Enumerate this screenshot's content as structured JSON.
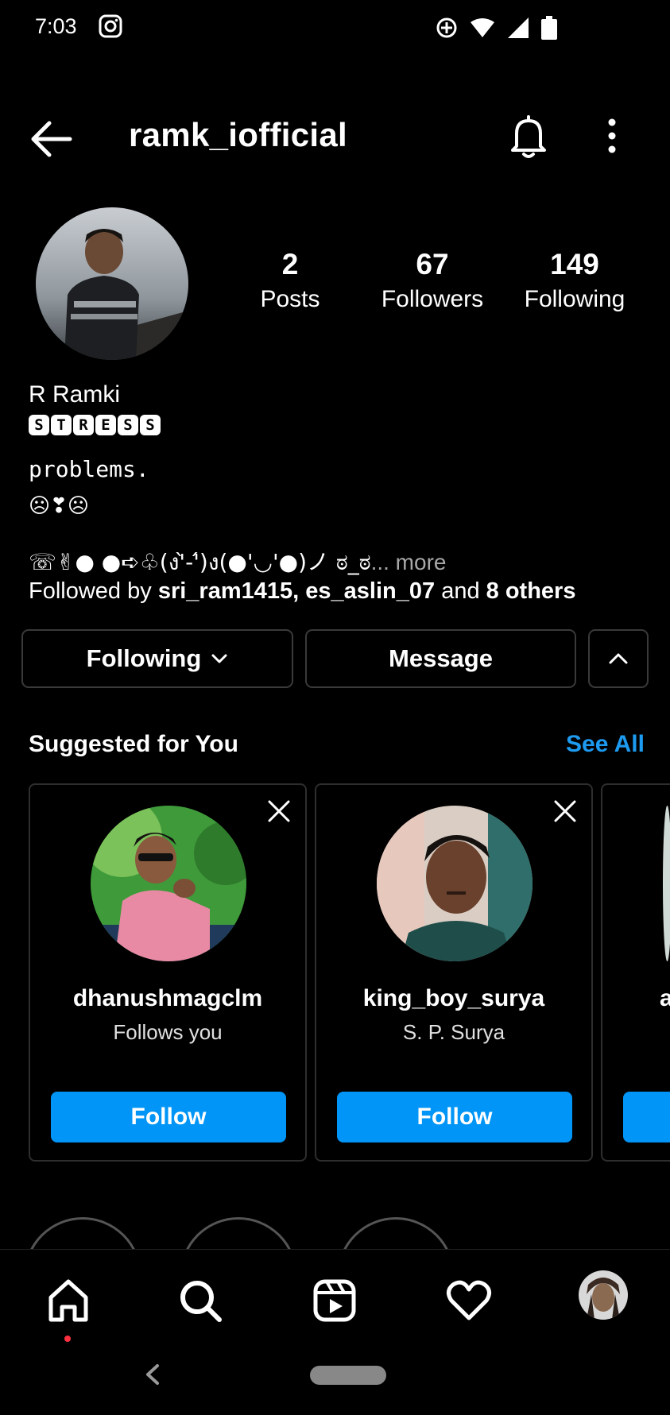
{
  "status_bar": {
    "time": "7:03"
  },
  "header": {
    "username": "ramk_iofficial"
  },
  "profile": {
    "stats": [
      {
        "value": "2",
        "label": "Posts"
      },
      {
        "value": "67",
        "label": "Followers"
      },
      {
        "value": "149",
        "label": "Following"
      }
    ],
    "name": "R Ramki",
    "boxed_letters": [
      "S",
      "T",
      "R",
      "E",
      "S",
      "S"
    ],
    "bio_mono": "problems.",
    "bio_emoji": "☹❣☹",
    "bio_line": "☏✌● ●➪♧(ง'̀-'́)ง(●'◡'●)ノ ಠ_ಠ",
    "bio_more": "... more",
    "followed_by": {
      "prefix": "Followed by",
      "user1": "sri_ram1415",
      "sep": ",",
      "user2": "es_aslin_07",
      "and_text": "and",
      "others": "8 others"
    }
  },
  "actions": {
    "following_label": "Following",
    "message_label": "Message"
  },
  "suggested": {
    "title": "Suggested for You",
    "see_all": "See All",
    "cards": [
      {
        "handle": "dhanushmagclm",
        "subtitle": "Follows you",
        "button": "Follow"
      },
      {
        "handle": "king_boy_surya",
        "subtitle": "S. P. Surya",
        "button": "Follow"
      },
      {
        "handle": "a",
        "subtitle": "",
        "button": ""
      }
    ]
  },
  "colors": {
    "background": "#000000",
    "accent_blue": "#0095f6",
    "see_all_blue": "#1d9bf0",
    "notification_dot": "#ff3040"
  },
  "icons": [
    "instagram-icon",
    "location-icon",
    "wifi-icon",
    "signal-icon",
    "battery-icon",
    "back-arrow-icon",
    "bell-icon",
    "more-vertical-icon",
    "chevron-down-icon",
    "chevron-up-icon",
    "close-icon",
    "home-icon",
    "search-icon",
    "reels-icon",
    "heart-icon"
  ]
}
